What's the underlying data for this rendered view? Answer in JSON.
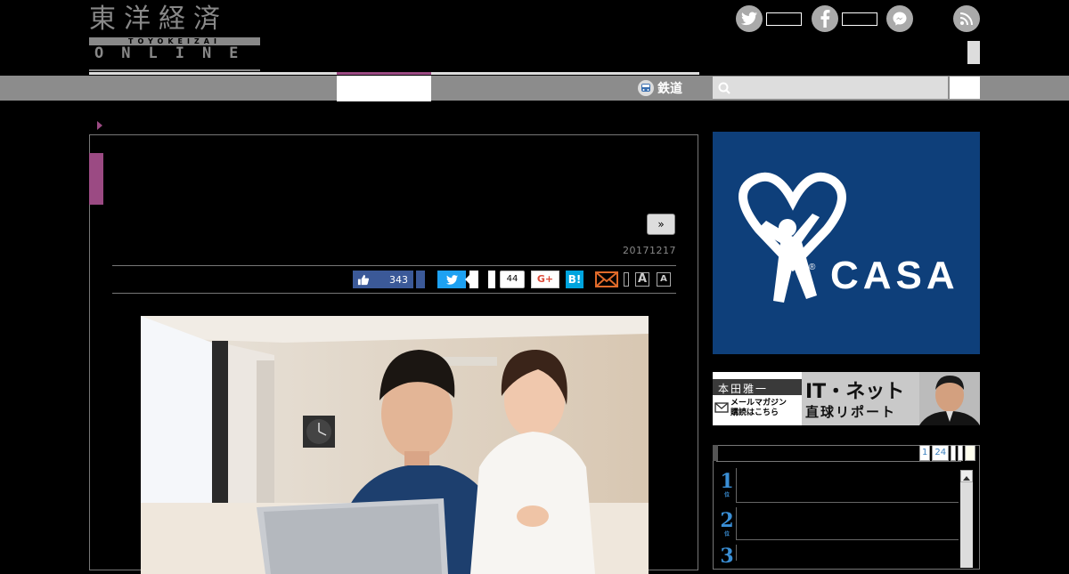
{
  "header": {
    "logo_kanji": "東洋経済",
    "logo_romaji": "TOYOKEIZAI",
    "logo_online": "ONLINE"
  },
  "social_top": [
    {
      "icon": "twitter-icon",
      "count": ""
    },
    {
      "icon": "facebook-icon",
      "count": ""
    },
    {
      "icon": "messenger-icon"
    },
    {
      "icon": "rss-icon"
    }
  ],
  "nav": {
    "rail_label": "鉄道",
    "search_placeholder": ""
  },
  "article": {
    "next_label": "»",
    "date": "20171217"
  },
  "share": {
    "like_count": "343",
    "comment_count": "44",
    "gplus_label": "G+",
    "hatena_label": "B!",
    "font_large": "A",
    "font_small": "A"
  },
  "sidebar": {
    "casa_text": "CASA",
    "casa_mark": "®",
    "honda_name": "本田雅一",
    "honda_title": "IT・ネット",
    "honda_sub": "直球リポート",
    "honda_mag1": "メールマガジン",
    "honda_mag2": "購読はこちら",
    "ranking_tabs": [
      "1",
      "24"
    ],
    "ranking_numbers": [
      "1",
      "2",
      "3"
    ],
    "ranking_suffix": "位"
  },
  "colors": {
    "accent": "#9b4a83",
    "nav": "#8c8c8c",
    "casa_blue": "#0e3f7a",
    "twitter": "#1da1f2",
    "facebook": "#3b5998",
    "hatena": "#00a4de"
  }
}
